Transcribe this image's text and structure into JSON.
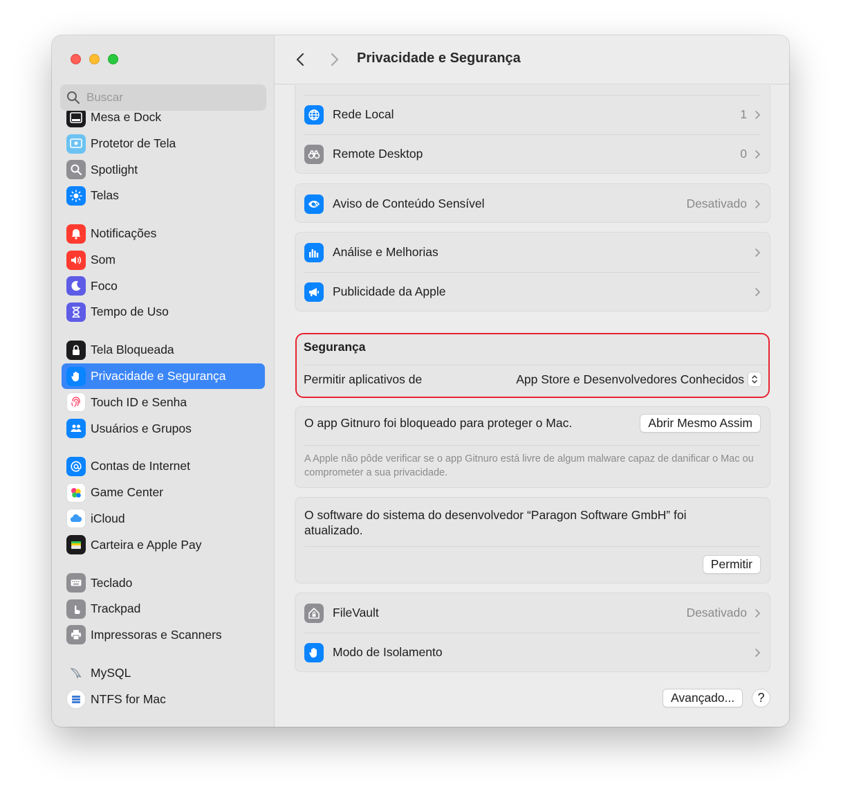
{
  "window": {
    "title": "Privacidade e Segurança"
  },
  "search": {
    "placeholder": "Buscar"
  },
  "sidebar": {
    "groups": [
      [
        {
          "label": "Mesa e Dock",
          "icon": "dock-icon",
          "color": "#1c1c1e"
        },
        {
          "label": "Protetor de Tela",
          "icon": "screensaver-icon",
          "color": "#5ac8fa"
        },
        {
          "label": "Spotlight",
          "icon": "magnifier-icon",
          "color": "#8e8e93"
        },
        {
          "label": "Telas",
          "icon": "sun-icon",
          "color": "#0a84ff"
        }
      ],
      [
        {
          "label": "Notificações",
          "icon": "bell-icon",
          "color": "#ff3b30"
        },
        {
          "label": "Som",
          "icon": "speaker-icon",
          "color": "#ff3b30"
        },
        {
          "label": "Foco",
          "icon": "moon-icon",
          "color": "#5e5ce6"
        },
        {
          "label": "Tempo de Uso",
          "icon": "hourglass-icon",
          "color": "#5e5ce6"
        }
      ],
      [
        {
          "label": "Tela Bloqueada",
          "icon": "lock-icon",
          "color": "#1c1c1e"
        },
        {
          "label": "Privacidade e Segurança",
          "icon": "hand-icon",
          "color": "#0a84ff",
          "active": true
        },
        {
          "label": "Touch ID e Senha",
          "icon": "fingerprint-icon",
          "color": "#ffffff"
        },
        {
          "label": "Usuários e Grupos",
          "icon": "users-icon",
          "color": "#0a84ff"
        }
      ],
      [
        {
          "label": "Contas de Internet",
          "icon": "at-icon",
          "color": "#0a84ff"
        },
        {
          "label": "Game Center",
          "icon": "game-center-icon",
          "color": "#ffffff"
        },
        {
          "label": "iCloud",
          "icon": "cloud-icon",
          "color": "#ffffff"
        },
        {
          "label": "Carteira e Apple Pay",
          "icon": "wallet-icon",
          "color": "#1c1c1e"
        }
      ],
      [
        {
          "label": "Teclado",
          "icon": "keyboard-icon",
          "color": "#8e8e93"
        },
        {
          "label": "Trackpad",
          "icon": "trackpad-icon",
          "color": "#8e8e93"
        },
        {
          "label": "Impressoras e Scanners",
          "icon": "printer-icon",
          "color": "#8e8e93"
        }
      ],
      [
        {
          "label": "MySQL",
          "icon": "dolphin-icon",
          "color": "transparent"
        },
        {
          "label": "NTFS for Mac",
          "icon": "ntfs-icon",
          "color": "#3e7bd6"
        }
      ]
    ]
  },
  "privacy": {
    "rede_local": {
      "label": "Rede Local",
      "value": "1"
    },
    "remote_desktop": {
      "label": "Remote Desktop",
      "value": "0"
    },
    "aviso": {
      "label": "Aviso de Conteúdo Sensível",
      "value": "Desativado"
    },
    "analise": {
      "label": "Análise e Melhorias"
    },
    "publicidade": {
      "label": "Publicidade da Apple"
    }
  },
  "security": {
    "title": "Segurança",
    "allow_label": "Permitir aplicativos de",
    "allow_value": "App Store e Desenvolvedores Conhecidos"
  },
  "blocked": {
    "message": "O app Gitnuro foi bloqueado para proteger o Mac.",
    "button": "Abrir Mesmo Assim",
    "detail": "A Apple não pôde verificar se o app Gitnuro está livre de algum malware capaz de danificar o Mac ou comprometer a sua privacidade."
  },
  "system_software": {
    "message": "O software do sistema do desenvolvedor “Paragon Software GmbH” foi atualizado.",
    "button": "Permitir"
  },
  "filevault": {
    "label": "FileVault",
    "value": "Desativado"
  },
  "isolamento": {
    "label": "Modo de Isolamento"
  },
  "footer": {
    "advanced_button": "Avançado...",
    "help_button": "?"
  }
}
